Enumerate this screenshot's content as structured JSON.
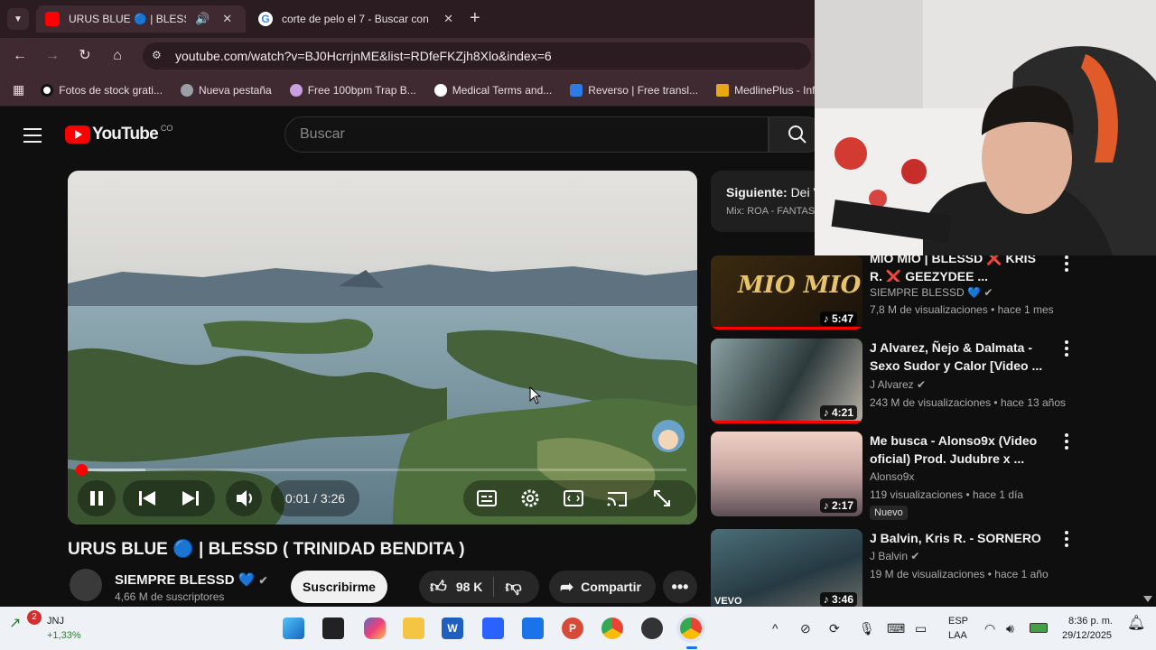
{
  "browser": {
    "tabs": [
      {
        "title": "URUS BLUE 🔵 | BLESSD ( T",
        "active": true
      },
      {
        "title": "corte de pelo el 7 - Buscar con",
        "active": false
      }
    ],
    "url": "youtube.com/watch?v=BJ0HcrrjnME&list=RDfeFKZjh8Xlo&index=6",
    "bookmarks": [
      "Fotos de stock grati...",
      "Nueva pestaña",
      "Free 100bpm Trap B...",
      "Medical Terms and...",
      "Reverso | Free transl...",
      "MedlinePlus - Inf"
    ]
  },
  "youtube": {
    "logo_text": "YouTube",
    "country": "CO",
    "search_placeholder": "Buscar",
    "player": {
      "time": "0:01 / 3:26",
      "progress_fraction": 0.005,
      "buffered_fraction": 0.11
    },
    "video_title": "URUS BLUE 🔵 | BLESSD ( TRINIDAD BENDITA )",
    "channel": {
      "name": "SIEMPRE BLESSD 💙",
      "subscribers": "4,66 M de suscriptores",
      "subscribe_label": "Suscribirme"
    },
    "actions": {
      "likes": "98 K",
      "share_label": "Compartir"
    },
    "up_next": {
      "label": "Siguiente:",
      "title": "Dei V",
      "mix": "Mix: ROA - FANTAS"
    },
    "recommendations": [
      {
        "title": "MIO MIO | BLESSD ❌ KRIS R. ❌ GEEZYDEE ...",
        "channel": "SIEMPRE BLESSD 💙",
        "meta": "7,8 M de visualizaciones • hace 1 mes",
        "duration": "5:47",
        "thumb_text": "MIO MIO",
        "watched": true
      },
      {
        "title": "J Alvarez, Ñejo & Dalmata - Sexo Sudor y Calor [Video ...",
        "channel": "J Alvarez",
        "meta": "243 M de visualizaciones • hace 13 años",
        "duration": "4:21",
        "watched": true
      },
      {
        "title": "Me busca - Alonso9x (Video oficial) Prod. Judubre x ...",
        "channel": "Alonso9x",
        "meta": "119 visualizaciones • hace 1 día",
        "duration": "2:17",
        "badge": "Nuevo"
      },
      {
        "title": "J Balvin, Kris R. - SORNERO",
        "channel": "J Balvin",
        "meta": "19 M de visualizaciones • hace 1 año",
        "duration": "3:46",
        "thumb_text": "VEVO"
      }
    ]
  },
  "taskbar": {
    "stock": {
      "symbol": "JNJ",
      "change": "+1,33%",
      "notifications": "2"
    },
    "lang": "ESP",
    "layout": "LAA",
    "time": "8:36 p. m.",
    "date": "29/12/2025"
  }
}
